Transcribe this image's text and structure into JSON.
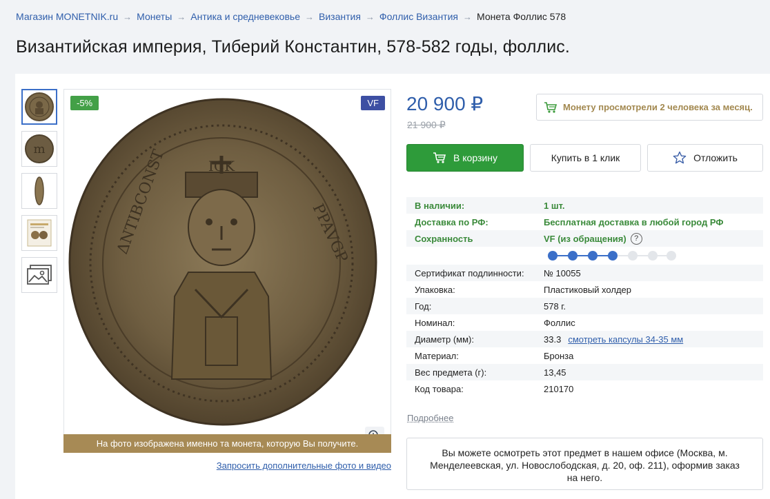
{
  "breadcrumb": {
    "items": [
      "Магазин MONETNIK.ru",
      "Монеты",
      "Антика и средневековье",
      "Византия",
      "Фоллис Византия"
    ],
    "current": "Монета Фоллис 578",
    "separator": "→"
  },
  "title": "Византийская империя, Тиберий Константин, 578-582 годы, фоллис.",
  "gallery": {
    "discount_badge": "-5%",
    "grade_badge": "VF",
    "caption": "На фото изображена именно та монета, которую Вы получите.",
    "request_link": "Запросить дополнительные фото и видео",
    "thumbnails": [
      "coin-obverse",
      "coin-reverse",
      "coin-edge",
      "certificate",
      "more-photos"
    ]
  },
  "price": {
    "current": "20 900 ₽",
    "old": "21 900 ₽"
  },
  "views_notice": "Монету просмотрели 2 человека за месяц.",
  "buttons": {
    "cart": "В корзину",
    "one_click": "Купить в 1 клик",
    "defer": "Отложить"
  },
  "specs": {
    "availability": {
      "label": "В наличии:",
      "value": "1 шт."
    },
    "delivery": {
      "label": "Доставка по РФ:",
      "value": "Бесплатная доставка в любой город РФ"
    },
    "condition": {
      "label": "Сохранность",
      "value": "VF (из обращения)",
      "help": "?",
      "scale_level": 4,
      "scale_total": 7
    },
    "certificate": {
      "label": "Сертификат подлинности:",
      "value": "№ 10055"
    },
    "packaging": {
      "label": "Упаковка:",
      "value": "Пластиковый холдер"
    },
    "year": {
      "label": "Год:",
      "value": "578 г."
    },
    "denomination": {
      "label": "Номинал:",
      "value": "Фоллис"
    },
    "diameter": {
      "label": "Диаметр (мм):",
      "value": "33.3",
      "link": "смотреть капсулы 34-35 мм"
    },
    "material": {
      "label": "Материал:",
      "value": "Бронза"
    },
    "weight": {
      "label": "Вес предмета (г):",
      "value": "13,45"
    },
    "sku": {
      "label": "Код товара:",
      "value": "210170"
    }
  },
  "more_link": "Подробнее",
  "office_notice": "Вы можете осмотреть этот предмет в нашем офисе (Москва, м. Менделеевская, ул. Новослободская, д. 20, оф. 211), оформив заказ на него.",
  "colors": {
    "accent_blue": "#2f5eab",
    "cart_green": "#2e9b3a",
    "gold_text": "#a2884f",
    "caption_bg": "#a78a55"
  }
}
